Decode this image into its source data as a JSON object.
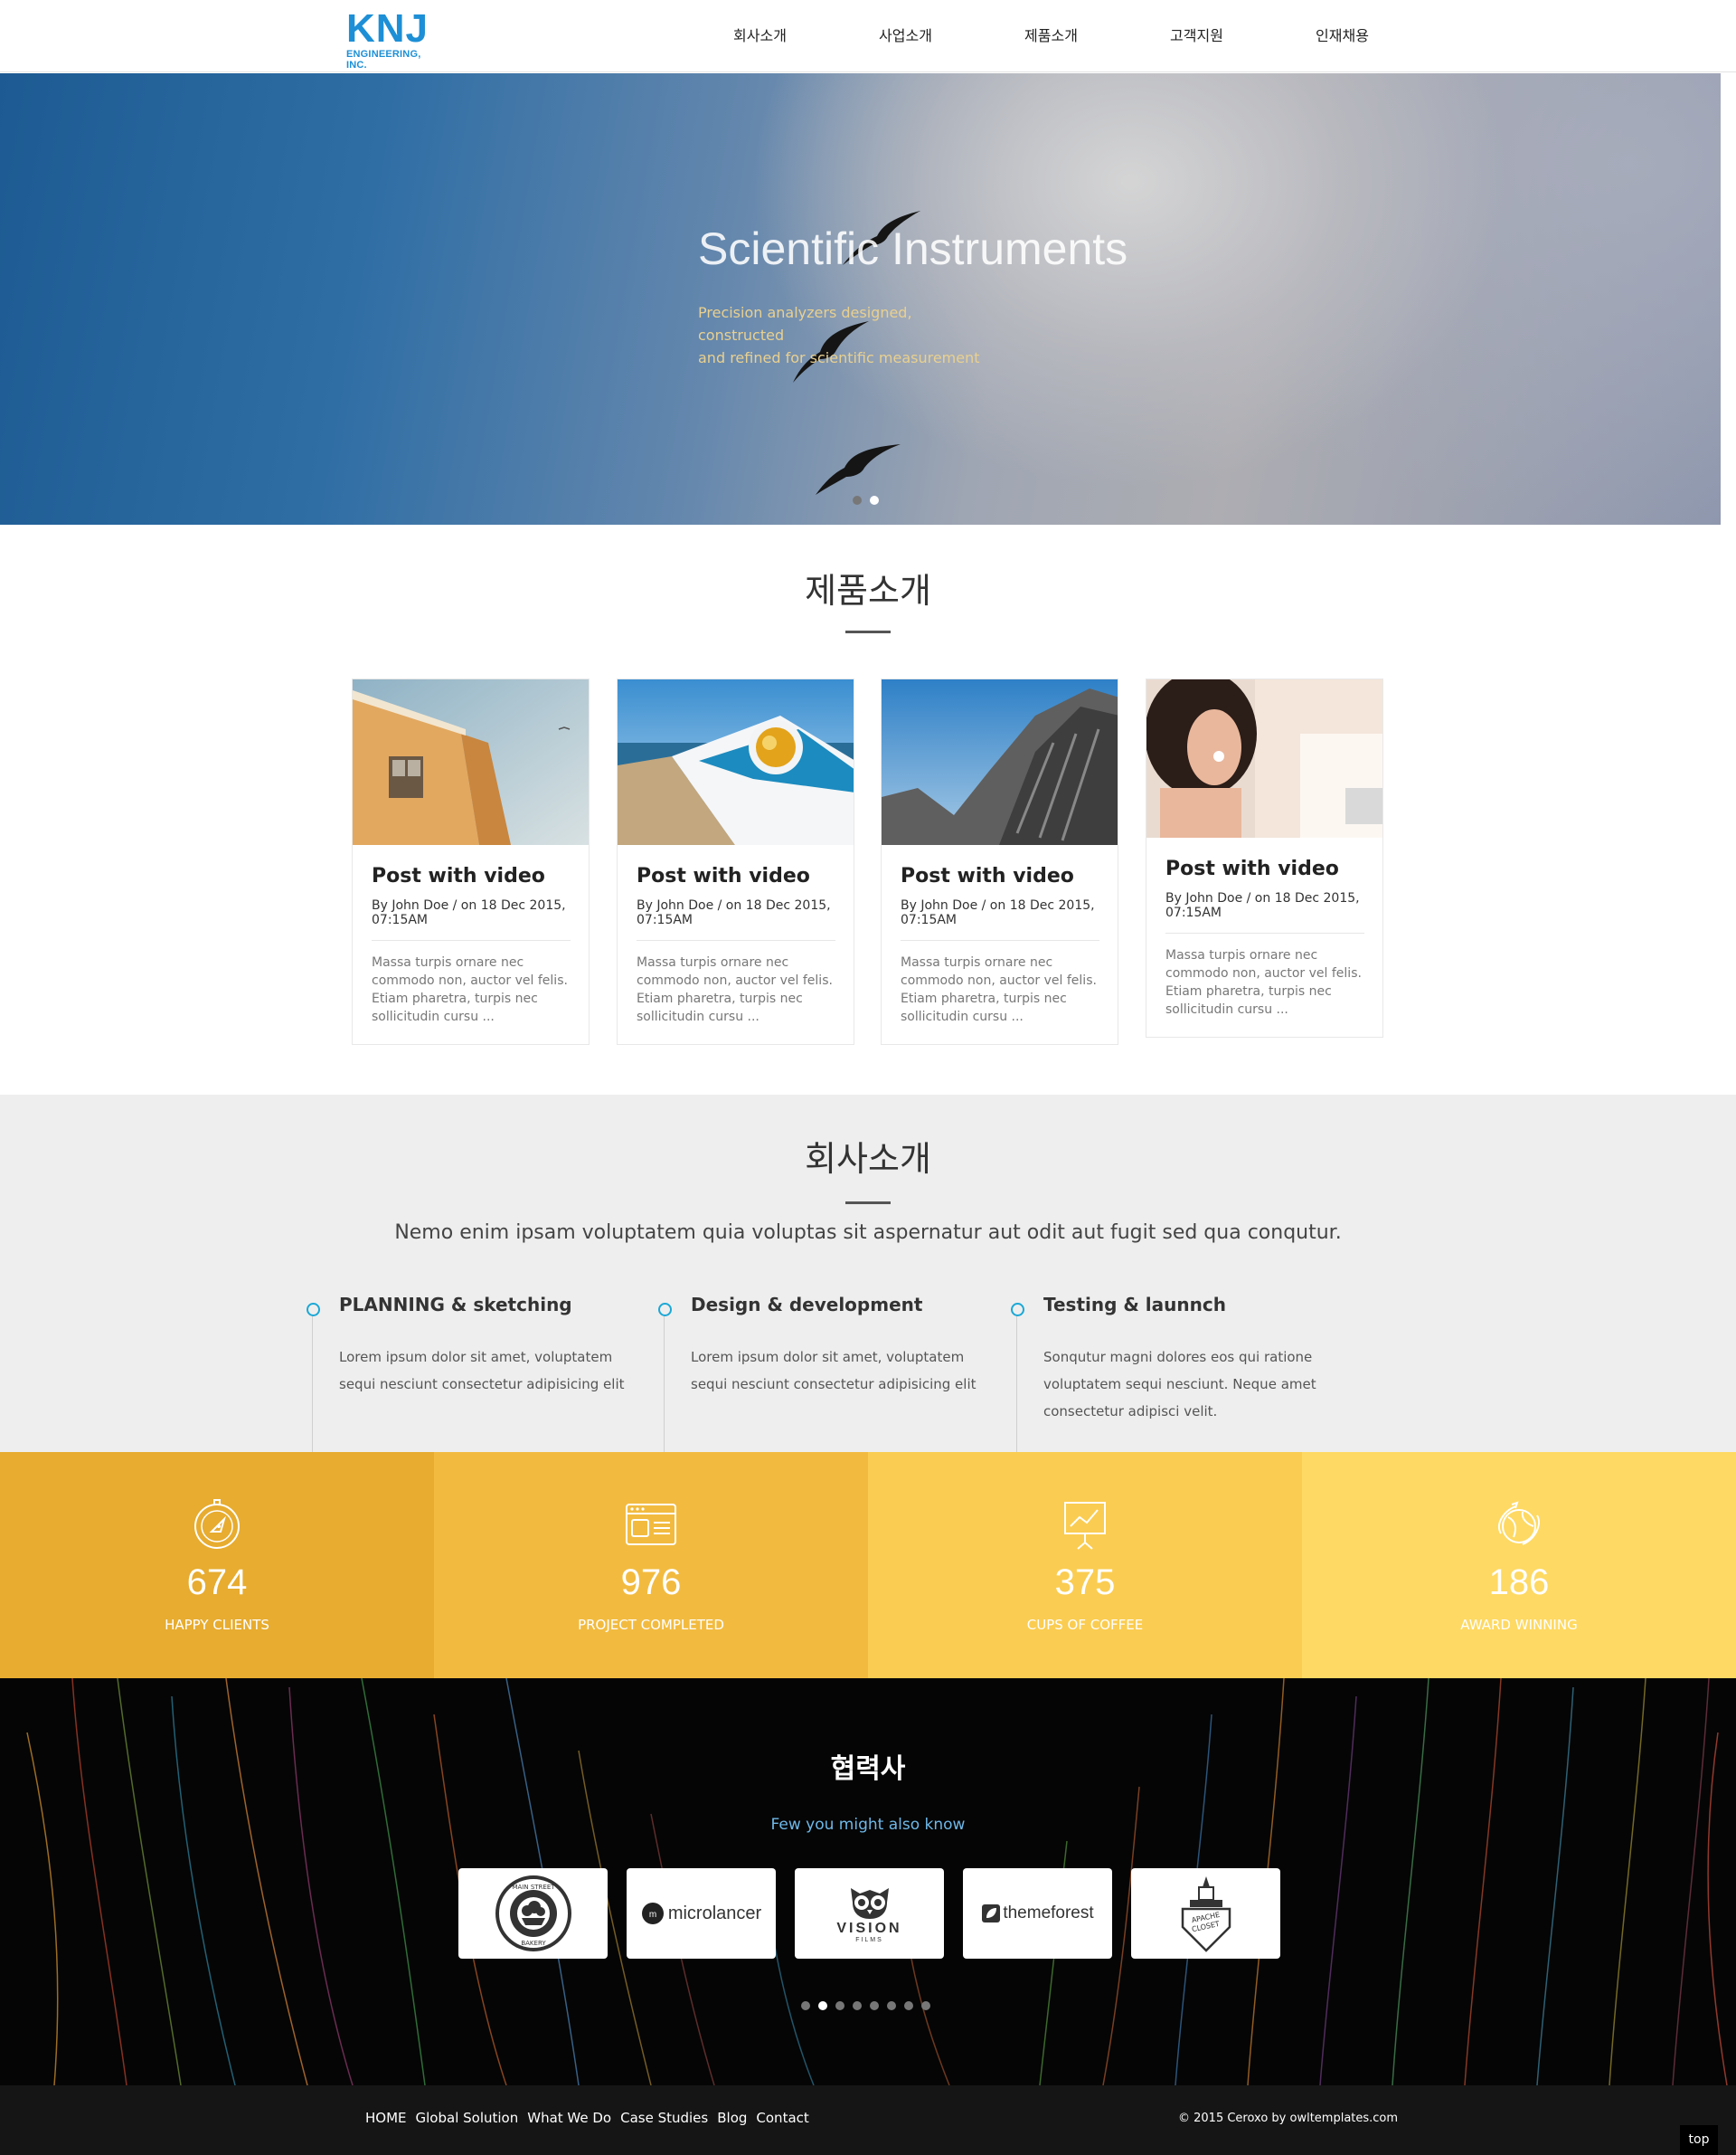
{
  "header": {
    "logo_text": "KNJ",
    "logo_subtext": "ENGINEERING, INC.",
    "nav": [
      "회사소개",
      "사업소개",
      "제품소개",
      "고객지원",
      "인재채용"
    ]
  },
  "hero": {
    "title": "Scientific Instruments",
    "line1": "Precision analyzers designed, constructed",
    "line2": "and refined for scientific measurement",
    "slide_count": 2,
    "active_slide": 2
  },
  "products": {
    "title": "제품소개",
    "cards": [
      {
        "title": "Post with video",
        "meta1": "By John Doe / on 18 Dec 2015,",
        "meta2": "07:15AM",
        "text": "Massa turpis ornare nec commodo non, auctor vel felis. Etiam pharetra, turpis nec sollicitudin cursu ..."
      },
      {
        "title": "Post with video",
        "meta1": "By John Doe / on 18 Dec 2015,",
        "meta2": "07:15AM",
        "text": "Massa turpis ornare nec commodo non, auctor vel felis. Etiam pharetra, turpis nec sollicitudin cursu ..."
      },
      {
        "title": "Post with video",
        "meta1": "By John Doe / on 18 Dec 2015,",
        "meta2": "07:15AM",
        "text": "Massa turpis ornare nec commodo non, auctor vel felis. Etiam pharetra, turpis nec sollicitudin cursu ..."
      },
      {
        "title": "Post with video",
        "meta1": "By John Doe / on 18 Dec 2015,",
        "meta2": "07:15AM",
        "text": "Massa turpis ornare nec commodo non, auctor vel felis. Etiam pharetra, turpis nec sollicitudin cursu ..."
      }
    ]
  },
  "about": {
    "title": "회사소개",
    "lead": "Nemo enim ipsam voluptatem quia voluptas sit aspernatur aut odit aut fugit sed qua conqutur.",
    "steps": [
      {
        "title": "PLANNING & sketching",
        "text": "Lorem ipsum dolor sit amet, voluptatem sequi nesciunt consectetur adipisicing elit"
      },
      {
        "title": "Design & development",
        "text": "Lorem ipsum dolor sit amet, voluptatem sequi nesciunt consectetur adipisicing elit"
      },
      {
        "title": "Testing & launnch",
        "text": "Sonqutur magni dolores eos qui ratione voluptatem sequi nesciunt. Neque amet consectetur adipisci velit."
      }
    ],
    "accent_color": "#1ba8d6"
  },
  "stats": [
    {
      "value": "674",
      "label": "HAPPY CLIENTS",
      "color": "#e7ac30",
      "icon": "compass-icon"
    },
    {
      "value": "976",
      "label": "PROJECT COMPLETED",
      "color": "#f2bb40",
      "icon": "browser-window-icon"
    },
    {
      "value": "375",
      "label": "CUPS OF COFFEE",
      "color": "#facc51",
      "icon": "presentation-chart-icon"
    },
    {
      "value": "186",
      "label": "AWARD WINNING",
      "color": "#fed963",
      "icon": "globe-icon"
    }
  ],
  "partners": {
    "title": "협력사",
    "subtitle": "Few you might also know",
    "logos": [
      {
        "name": "main-street-bakery",
        "line1": "MAIN STREET",
        "line2": "BAKERY"
      },
      {
        "name": "microlancer",
        "text": "microlancer",
        "badge": "m"
      },
      {
        "name": "vision-films",
        "text": "VISION",
        "sub": "FILMS"
      },
      {
        "name": "themeforest",
        "text": "themeforest"
      },
      {
        "name": "apache-closet",
        "line1": "APACHE",
        "line2": "CLOSET"
      }
    ],
    "dot_count": 8,
    "active_dot": 2
  },
  "footer": {
    "links": [
      "HOME",
      "Global Solution",
      "What We Do",
      "Case Studies",
      "Blog",
      "Contact"
    ],
    "copyright": "© 2015 Ceroxo by owltemplates.com",
    "top_label": "top"
  }
}
